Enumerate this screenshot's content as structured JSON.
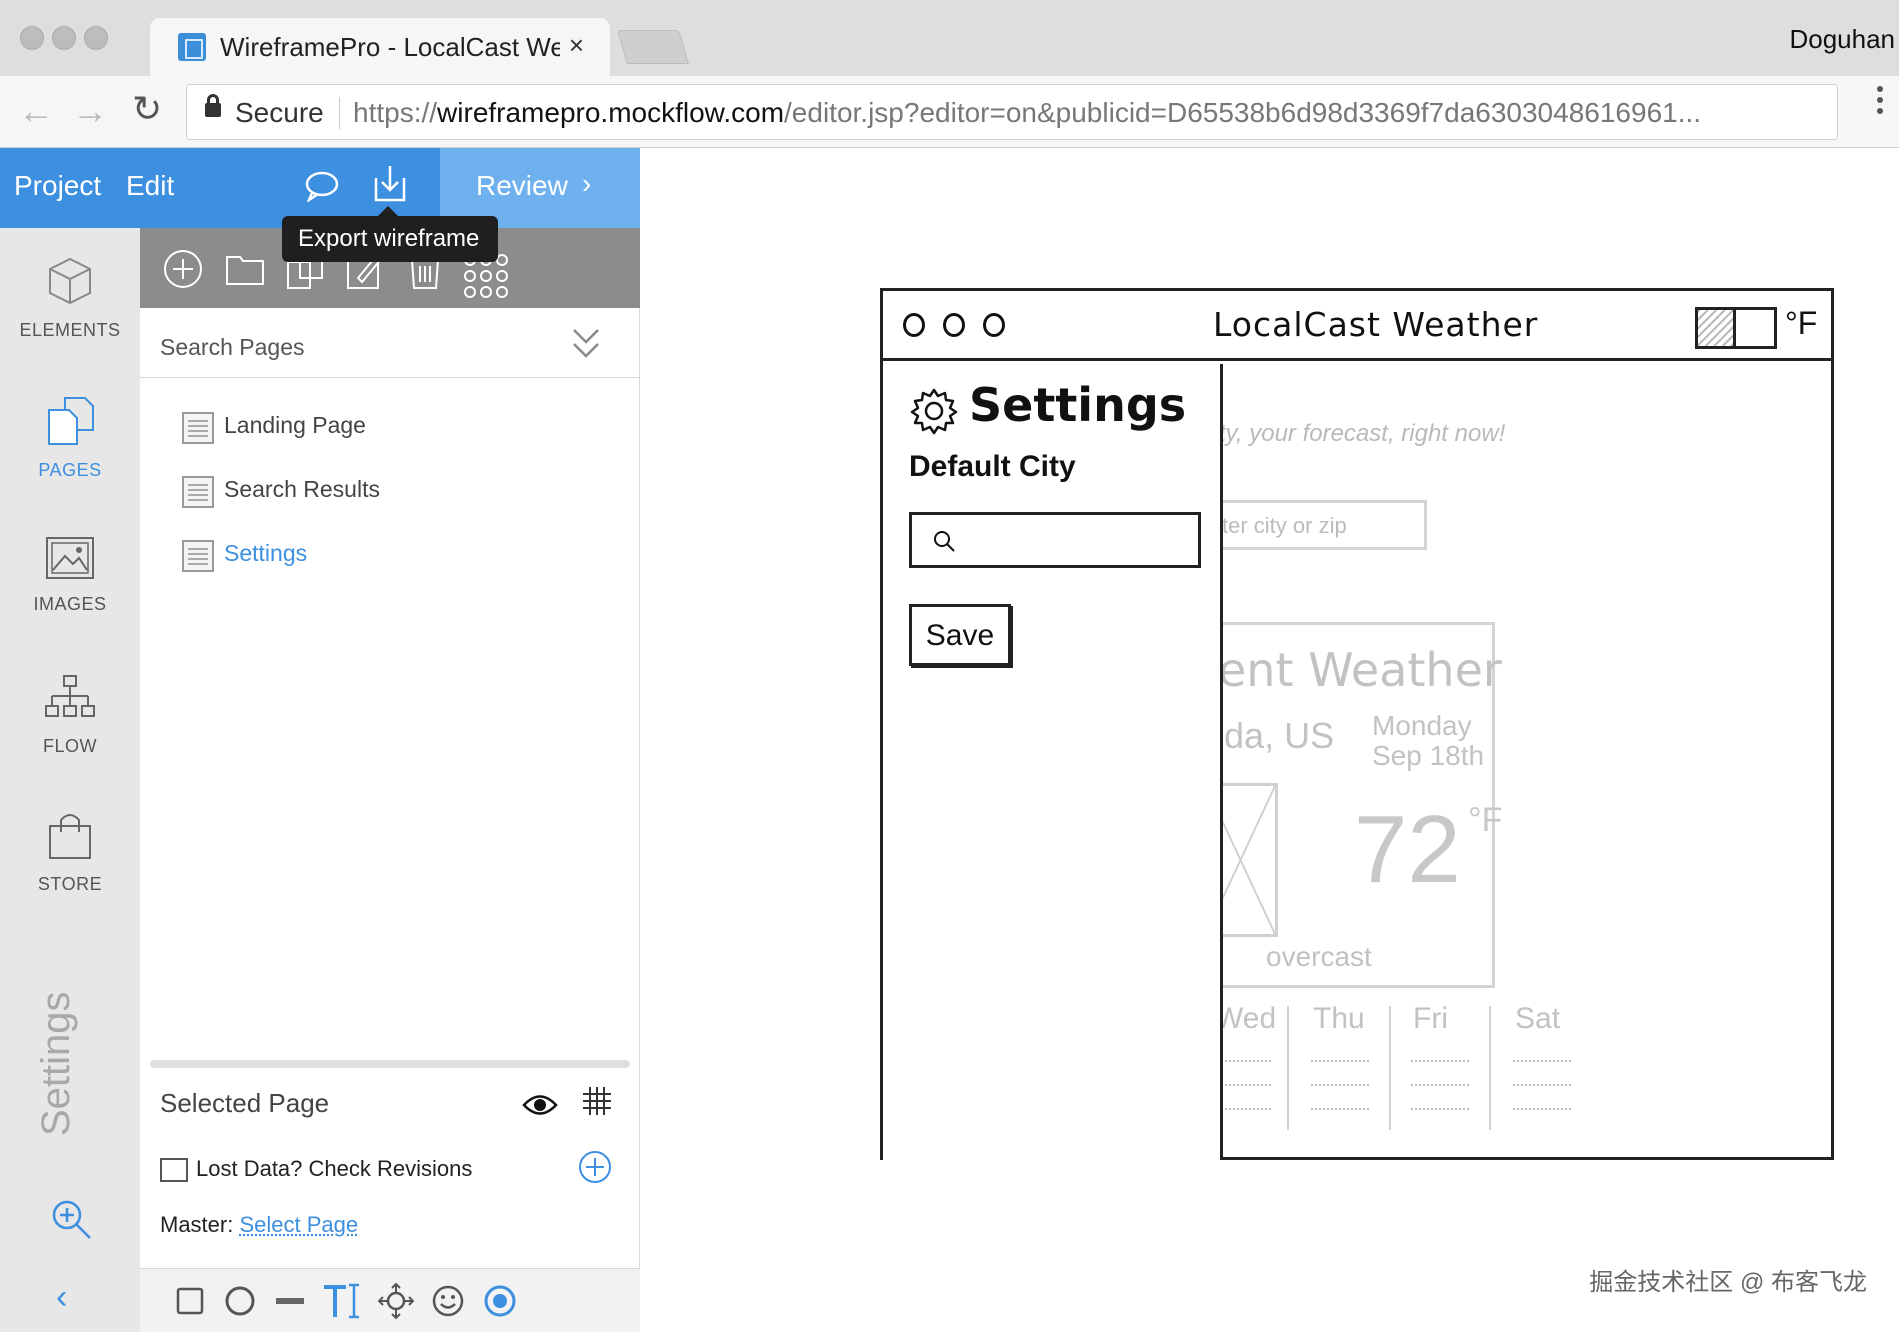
{
  "browser": {
    "tab_title": "WireframePro - LocalCast Wea",
    "tab_close": "×",
    "profile_name": "Doguhan",
    "secure_label": "Secure",
    "url_protocol": "https://",
    "url_host": "wireframepro.mockflow.com",
    "url_path": "/editor.jsp?editor=on&publicid=D65538b6d98d3369f7da6303048616961..."
  },
  "appbar": {
    "menu_project": "Project",
    "menu_edit": "Edit",
    "review_label": "Review",
    "review_chevron": "›",
    "tooltip": "Export wireframe",
    "accent_color": "#3d8fe0"
  },
  "rail": {
    "items": [
      {
        "label": "ELEMENTS",
        "icon": "cube-icon"
      },
      {
        "label": "PAGES",
        "icon": "pages-icon",
        "active": true
      },
      {
        "label": "IMAGES",
        "icon": "image-icon"
      },
      {
        "label": "FLOW",
        "icon": "flow-icon"
      },
      {
        "label": "STORE",
        "icon": "bag-icon"
      }
    ],
    "settings_label": "Settings",
    "collapse_glyph": "‹"
  },
  "panel": {
    "search_placeholder": "Search Pages",
    "pages": [
      {
        "label": "Landing Page"
      },
      {
        "label": "Search Results"
      },
      {
        "label": "Settings",
        "selected": true
      }
    ],
    "selected_page_label": "Selected Page",
    "revisions_label": "Lost Data? Check Revisions",
    "master_label": "Master:",
    "master_link": "Select Page"
  },
  "wireframe": {
    "title": "LocalCast Weather",
    "unit": "°F",
    "settings_title": "Settings",
    "default_city_label": "Default City",
    "save_label": "Save",
    "tagline": "ty, your forecast, right now!",
    "search_placeholder": "ter city or zip",
    "card_title": "rrent Weather",
    "location": "esda, US",
    "date_day": "Monday",
    "date_date": "Sep 18th",
    "temperature": "72",
    "temperature_unit": "°F",
    "condition": "overcast",
    "days": [
      "Wed",
      "Thu",
      "Fri",
      "Sat"
    ]
  },
  "watermark": "掘金技术社区 @ 布客飞龙"
}
